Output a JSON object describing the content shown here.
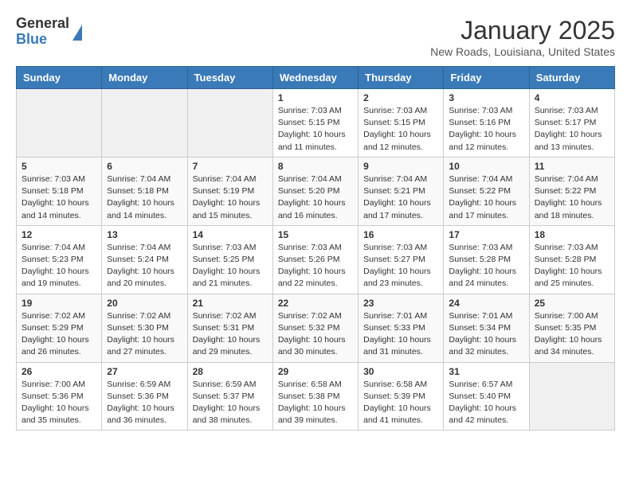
{
  "header": {
    "logo_general": "General",
    "logo_blue": "Blue",
    "month_title": "January 2025",
    "location": "New Roads, Louisiana, United States"
  },
  "weekdays": [
    "Sunday",
    "Monday",
    "Tuesday",
    "Wednesday",
    "Thursday",
    "Friday",
    "Saturday"
  ],
  "weeks": [
    [
      {
        "day": "",
        "sunrise": "",
        "sunset": "",
        "daylight": "",
        "empty": true
      },
      {
        "day": "",
        "sunrise": "",
        "sunset": "",
        "daylight": "",
        "empty": true
      },
      {
        "day": "",
        "sunrise": "",
        "sunset": "",
        "daylight": "",
        "empty": true
      },
      {
        "day": "1",
        "sunrise": "Sunrise: 7:03 AM",
        "sunset": "Sunset: 5:15 PM",
        "daylight": "Daylight: 10 hours and 11 minutes."
      },
      {
        "day": "2",
        "sunrise": "Sunrise: 7:03 AM",
        "sunset": "Sunset: 5:15 PM",
        "daylight": "Daylight: 10 hours and 12 minutes."
      },
      {
        "day": "3",
        "sunrise": "Sunrise: 7:03 AM",
        "sunset": "Sunset: 5:16 PM",
        "daylight": "Daylight: 10 hours and 12 minutes."
      },
      {
        "day": "4",
        "sunrise": "Sunrise: 7:03 AM",
        "sunset": "Sunset: 5:17 PM",
        "daylight": "Daylight: 10 hours and 13 minutes."
      }
    ],
    [
      {
        "day": "5",
        "sunrise": "Sunrise: 7:03 AM",
        "sunset": "Sunset: 5:18 PM",
        "daylight": "Daylight: 10 hours and 14 minutes."
      },
      {
        "day": "6",
        "sunrise": "Sunrise: 7:04 AM",
        "sunset": "Sunset: 5:18 PM",
        "daylight": "Daylight: 10 hours and 14 minutes."
      },
      {
        "day": "7",
        "sunrise": "Sunrise: 7:04 AM",
        "sunset": "Sunset: 5:19 PM",
        "daylight": "Daylight: 10 hours and 15 minutes."
      },
      {
        "day": "8",
        "sunrise": "Sunrise: 7:04 AM",
        "sunset": "Sunset: 5:20 PM",
        "daylight": "Daylight: 10 hours and 16 minutes."
      },
      {
        "day": "9",
        "sunrise": "Sunrise: 7:04 AM",
        "sunset": "Sunset: 5:21 PM",
        "daylight": "Daylight: 10 hours and 17 minutes."
      },
      {
        "day": "10",
        "sunrise": "Sunrise: 7:04 AM",
        "sunset": "Sunset: 5:22 PM",
        "daylight": "Daylight: 10 hours and 17 minutes."
      },
      {
        "day": "11",
        "sunrise": "Sunrise: 7:04 AM",
        "sunset": "Sunset: 5:22 PM",
        "daylight": "Daylight: 10 hours and 18 minutes."
      }
    ],
    [
      {
        "day": "12",
        "sunrise": "Sunrise: 7:04 AM",
        "sunset": "Sunset: 5:23 PM",
        "daylight": "Daylight: 10 hours and 19 minutes."
      },
      {
        "day": "13",
        "sunrise": "Sunrise: 7:04 AM",
        "sunset": "Sunset: 5:24 PM",
        "daylight": "Daylight: 10 hours and 20 minutes."
      },
      {
        "day": "14",
        "sunrise": "Sunrise: 7:03 AM",
        "sunset": "Sunset: 5:25 PM",
        "daylight": "Daylight: 10 hours and 21 minutes."
      },
      {
        "day": "15",
        "sunrise": "Sunrise: 7:03 AM",
        "sunset": "Sunset: 5:26 PM",
        "daylight": "Daylight: 10 hours and 22 minutes."
      },
      {
        "day": "16",
        "sunrise": "Sunrise: 7:03 AM",
        "sunset": "Sunset: 5:27 PM",
        "daylight": "Daylight: 10 hours and 23 minutes."
      },
      {
        "day": "17",
        "sunrise": "Sunrise: 7:03 AM",
        "sunset": "Sunset: 5:28 PM",
        "daylight": "Daylight: 10 hours and 24 minutes."
      },
      {
        "day": "18",
        "sunrise": "Sunrise: 7:03 AM",
        "sunset": "Sunset: 5:28 PM",
        "daylight": "Daylight: 10 hours and 25 minutes."
      }
    ],
    [
      {
        "day": "19",
        "sunrise": "Sunrise: 7:02 AM",
        "sunset": "Sunset: 5:29 PM",
        "daylight": "Daylight: 10 hours and 26 minutes."
      },
      {
        "day": "20",
        "sunrise": "Sunrise: 7:02 AM",
        "sunset": "Sunset: 5:30 PM",
        "daylight": "Daylight: 10 hours and 27 minutes."
      },
      {
        "day": "21",
        "sunrise": "Sunrise: 7:02 AM",
        "sunset": "Sunset: 5:31 PM",
        "daylight": "Daylight: 10 hours and 29 minutes."
      },
      {
        "day": "22",
        "sunrise": "Sunrise: 7:02 AM",
        "sunset": "Sunset: 5:32 PM",
        "daylight": "Daylight: 10 hours and 30 minutes."
      },
      {
        "day": "23",
        "sunrise": "Sunrise: 7:01 AM",
        "sunset": "Sunset: 5:33 PM",
        "daylight": "Daylight: 10 hours and 31 minutes."
      },
      {
        "day": "24",
        "sunrise": "Sunrise: 7:01 AM",
        "sunset": "Sunset: 5:34 PM",
        "daylight": "Daylight: 10 hours and 32 minutes."
      },
      {
        "day": "25",
        "sunrise": "Sunrise: 7:00 AM",
        "sunset": "Sunset: 5:35 PM",
        "daylight": "Daylight: 10 hours and 34 minutes."
      }
    ],
    [
      {
        "day": "26",
        "sunrise": "Sunrise: 7:00 AM",
        "sunset": "Sunset: 5:36 PM",
        "daylight": "Daylight: 10 hours and 35 minutes."
      },
      {
        "day": "27",
        "sunrise": "Sunrise: 6:59 AM",
        "sunset": "Sunset: 5:36 PM",
        "daylight": "Daylight: 10 hours and 36 minutes."
      },
      {
        "day": "28",
        "sunrise": "Sunrise: 6:59 AM",
        "sunset": "Sunset: 5:37 PM",
        "daylight": "Daylight: 10 hours and 38 minutes."
      },
      {
        "day": "29",
        "sunrise": "Sunrise: 6:58 AM",
        "sunset": "Sunset: 5:38 PM",
        "daylight": "Daylight: 10 hours and 39 minutes."
      },
      {
        "day": "30",
        "sunrise": "Sunrise: 6:58 AM",
        "sunset": "Sunset: 5:39 PM",
        "daylight": "Daylight: 10 hours and 41 minutes."
      },
      {
        "day": "31",
        "sunrise": "Sunrise: 6:57 AM",
        "sunset": "Sunset: 5:40 PM",
        "daylight": "Daylight: 10 hours and 42 minutes."
      },
      {
        "day": "",
        "sunrise": "",
        "sunset": "",
        "daylight": "",
        "empty": true
      }
    ]
  ]
}
